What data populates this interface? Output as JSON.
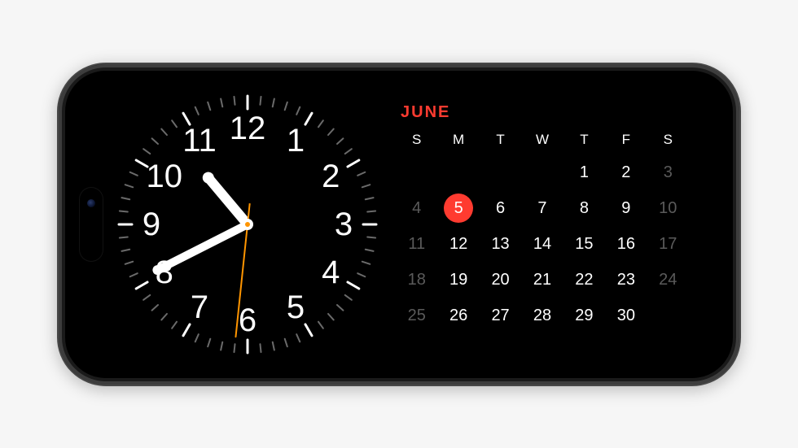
{
  "clock": {
    "numerals": [
      "12",
      "1",
      "2",
      "3",
      "4",
      "5",
      "6",
      "7",
      "8",
      "9",
      "10",
      "11"
    ],
    "hours": 10,
    "minutes": 40,
    "seconds": 31,
    "tick_color_major": "#ffffff",
    "tick_color_minor": "#6a6a6a",
    "second_hand_color": "#ff9500"
  },
  "calendar": {
    "month_label": "JUNE",
    "accent_color": "#ff3b30",
    "days_of_week": [
      "S",
      "M",
      "T",
      "W",
      "T",
      "F",
      "S"
    ],
    "today": 5,
    "weeks": [
      [
        {
          "n": null,
          "out": false
        },
        {
          "n": null,
          "out": false
        },
        {
          "n": null,
          "out": false
        },
        {
          "n": null,
          "out": false
        },
        {
          "n": 1,
          "out": false
        },
        {
          "n": 2,
          "out": false
        },
        {
          "n": 3,
          "out": true
        }
      ],
      [
        {
          "n": 4,
          "out": true
        },
        {
          "n": 5,
          "out": false
        },
        {
          "n": 6,
          "out": false
        },
        {
          "n": 7,
          "out": false
        },
        {
          "n": 8,
          "out": false
        },
        {
          "n": 9,
          "out": false
        },
        {
          "n": 10,
          "out": true
        }
      ],
      [
        {
          "n": 11,
          "out": true
        },
        {
          "n": 12,
          "out": false
        },
        {
          "n": 13,
          "out": false
        },
        {
          "n": 14,
          "out": false
        },
        {
          "n": 15,
          "out": false
        },
        {
          "n": 16,
          "out": false
        },
        {
          "n": 17,
          "out": true
        }
      ],
      [
        {
          "n": 18,
          "out": true
        },
        {
          "n": 19,
          "out": false
        },
        {
          "n": 20,
          "out": false
        },
        {
          "n": 21,
          "out": false
        },
        {
          "n": 22,
          "out": false
        },
        {
          "n": 23,
          "out": false
        },
        {
          "n": 24,
          "out": true
        }
      ],
      [
        {
          "n": 25,
          "out": true
        },
        {
          "n": 26,
          "out": false
        },
        {
          "n": 27,
          "out": false
        },
        {
          "n": 28,
          "out": false
        },
        {
          "n": 29,
          "out": false
        },
        {
          "n": 30,
          "out": false
        },
        {
          "n": null,
          "out": false
        }
      ]
    ]
  }
}
